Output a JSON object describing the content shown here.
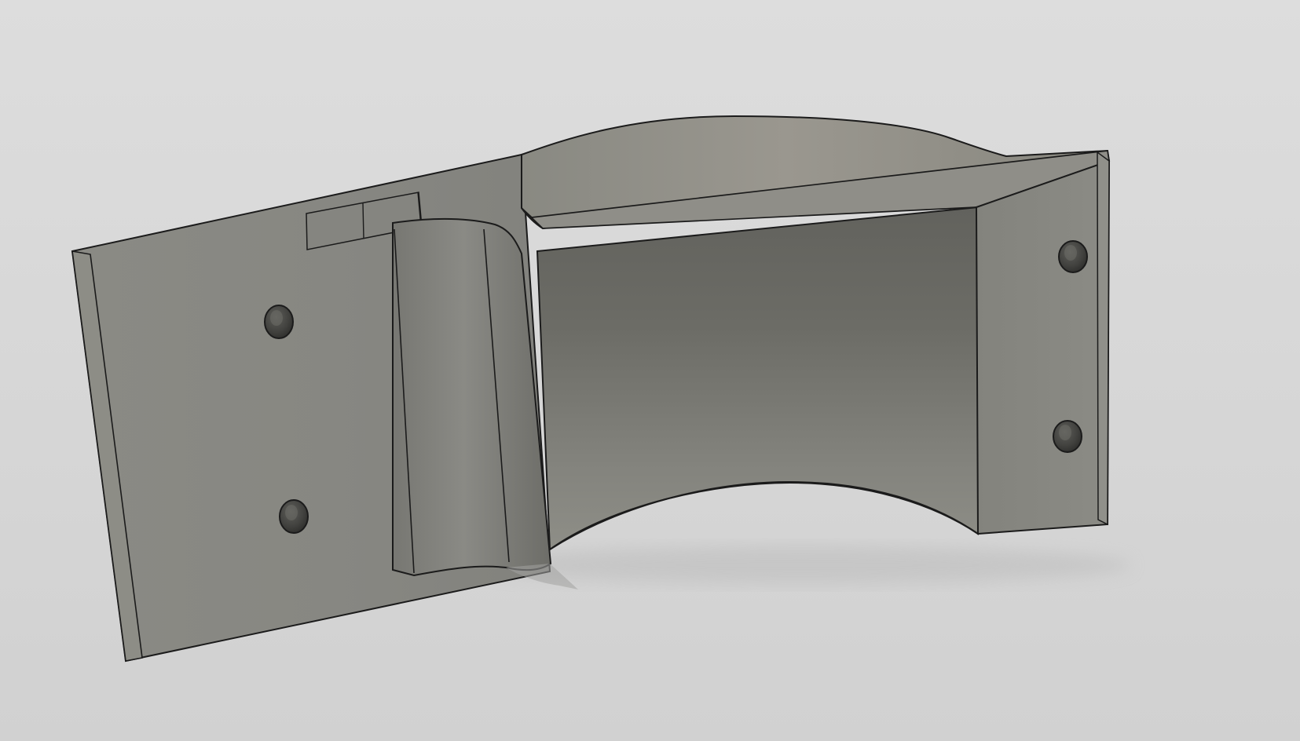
{
  "app": {
    "view": "3d-model-viewport",
    "background_color": "#d8d8d8"
  },
  "model": {
    "name": "",
    "material_color": "#8d8d86",
    "edge_color": "#1b1b1b",
    "shadow_color": "#b9b9b9",
    "hole_count": 4
  }
}
